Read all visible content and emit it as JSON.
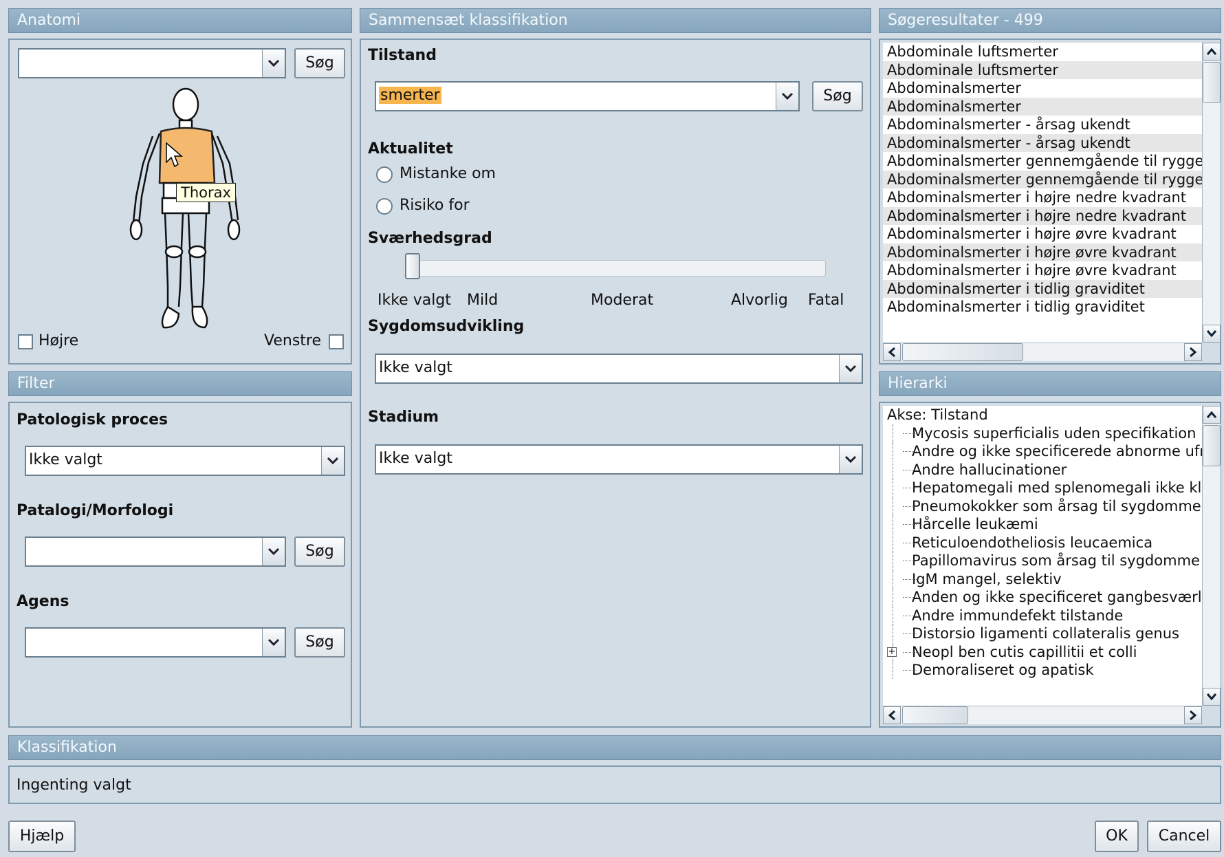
{
  "anatomy": {
    "title": "Anatomi",
    "search_value": "",
    "search_button": "Søg",
    "highlighted_region": "Thorax",
    "tooltip": "Thorax",
    "right_label": "Højre",
    "left_label": "Venstre",
    "highlight_color": "#f4b96e"
  },
  "filter": {
    "title": "Filter",
    "pathologic_process": {
      "label": "Patologisk proces",
      "value": "Ikke valgt"
    },
    "pathology_morphology": {
      "label": "Patalogi/Morfologi",
      "value": "",
      "button": "Søg"
    },
    "agens": {
      "label": "Agens",
      "value": "",
      "button": "Søg"
    }
  },
  "compose": {
    "title": "Sammensæt klassifikation",
    "condition": {
      "label": "Tilstand",
      "value": "smerter",
      "button": "Søg",
      "highlight_color": "#f7b54f"
    },
    "actuality": {
      "label": "Aktualitet",
      "options": [
        "Mistanke om",
        "Risiko for"
      ],
      "selected": null
    },
    "severity": {
      "label": "Sværhedsgrad",
      "scale": [
        "Ikke valgt",
        "Mild",
        "Moderat",
        "Alvorlig",
        "Fatal"
      ],
      "value": "Ikke valgt"
    },
    "development": {
      "label": "Sygdomsudvikling",
      "value": "Ikke valgt"
    },
    "stage": {
      "label": "Stadium",
      "value": "Ikke valgt"
    }
  },
  "results": {
    "title": "Søgeresultater - 499",
    "items": [
      "Abdominale luftsmerter",
      "Abdominale luftsmerter",
      "Abdominalsmerter",
      "Abdominalsmerter",
      "Abdominalsmerter - årsag ukendt",
      "Abdominalsmerter - årsag ukendt",
      "Abdominalsmerter gennemgående til ryggen",
      "Abdominalsmerter gennemgående til ryggen",
      "Abdominalsmerter i højre nedre kvadrant",
      "Abdominalsmerter i højre nedre kvadrant",
      "Abdominalsmerter i højre øvre kvadrant",
      "Abdominalsmerter i højre øvre kvadrant",
      "Abdominalsmerter i højre øvre kvadrant",
      "Abdominalsmerter i tidlig graviditet",
      "Abdominalsmerter i tidlig graviditet"
    ]
  },
  "hierarchy": {
    "title": "Hierarki",
    "root": "Akse: Tilstand",
    "items": [
      "Mycosis superficialis uden specifikation",
      "Andre og ikke specificerede abnorme ufrivillige bevægelser",
      "Andre hallucinationer",
      "Hepatomegali med splenomegali ikke klassificeret andetsteds",
      "Pneumokokker som årsag til sygdomme klassificeret andetsteds",
      "Hårcelle leukæmi",
      "Reticuloendotheliosis leucaemica",
      "Papillomavirus som årsag til sygdomme klassificeret andetsteds",
      "IgM mangel, selektiv",
      "Anden og ikke specificeret gangbesværlighed",
      "Andre immundefekt tilstande",
      "Distorsio ligamenti collateralis genus",
      "Neopl ben cutis capillitii et colli",
      "Demoraliseret og apatisk"
    ],
    "expandable_index": 12
  },
  "classification": {
    "title": "Klassifikation",
    "value": "Ingenting valgt"
  },
  "footer": {
    "help_button": "Hjælp",
    "ok_button": "OK",
    "cancel_button": "Cancel"
  }
}
